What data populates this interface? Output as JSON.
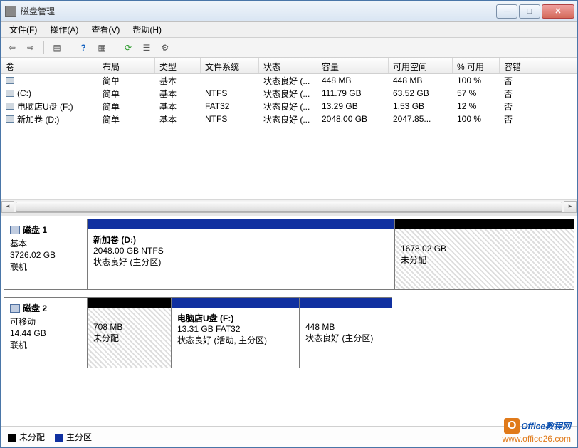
{
  "window": {
    "title": "磁盘管理"
  },
  "menu": {
    "file": "文件(F)",
    "action": "操作(A)",
    "view": "查看(V)",
    "help": "帮助(H)"
  },
  "columns": {
    "vol": "卷",
    "layout": "布局",
    "type": "类型",
    "fs": "文件系统",
    "status": "状态",
    "cap": "容量",
    "free": "可用空间",
    "pct": "% 可用",
    "ft": "容错"
  },
  "volumes": [
    {
      "name": "",
      "layout": "简单",
      "type": "基本",
      "fs": "",
      "status": "状态良好 (...",
      "cap": "448 MB",
      "free": "448 MB",
      "pct": "100 %",
      "ft": "否"
    },
    {
      "name": "(C:)",
      "layout": "简单",
      "type": "基本",
      "fs": "NTFS",
      "status": "状态良好 (...",
      "cap": "111.79 GB",
      "free": "63.52 GB",
      "pct": "57 %",
      "ft": "否"
    },
    {
      "name": "电脑店U盘 (F:)",
      "layout": "简单",
      "type": "基本",
      "fs": "FAT32",
      "status": "状态良好 (...",
      "cap": "13.29 GB",
      "free": "1.53 GB",
      "pct": "12 %",
      "ft": "否"
    },
    {
      "name": "新加卷 (D:)",
      "layout": "简单",
      "type": "基本",
      "fs": "NTFS",
      "status": "状态良好 (...",
      "cap": "2048.00 GB",
      "free": "2047.85...",
      "pct": "100 %",
      "ft": "否"
    }
  ],
  "disk1": {
    "title": "磁盘 1",
    "btype": "基本",
    "size": "3726.02 GB",
    "state": "联机",
    "p1": {
      "name": "新加卷  (D:)",
      "detail": "2048.00 GB NTFS",
      "status": "状态良好 (主分区)"
    },
    "p2": {
      "detail": "1678.02 GB",
      "status": "未分配"
    }
  },
  "disk2": {
    "title": "磁盘 2",
    "btype": "可移动",
    "size": "14.44 GB",
    "state": "联机",
    "p1": {
      "detail": "708 MB",
      "status": "未分配"
    },
    "p2": {
      "name": "电脑店U盘  (F:)",
      "detail": "13.31 GB FAT32",
      "status": "状态良好 (活动, 主分区)"
    },
    "p3": {
      "detail": "448 MB",
      "status": "状态良好 (主分区)"
    }
  },
  "legend": {
    "unalloc": "未分配",
    "primary": "主分区"
  },
  "watermark": {
    "line1": "Office教程网",
    "line2": "www.office26.com"
  }
}
